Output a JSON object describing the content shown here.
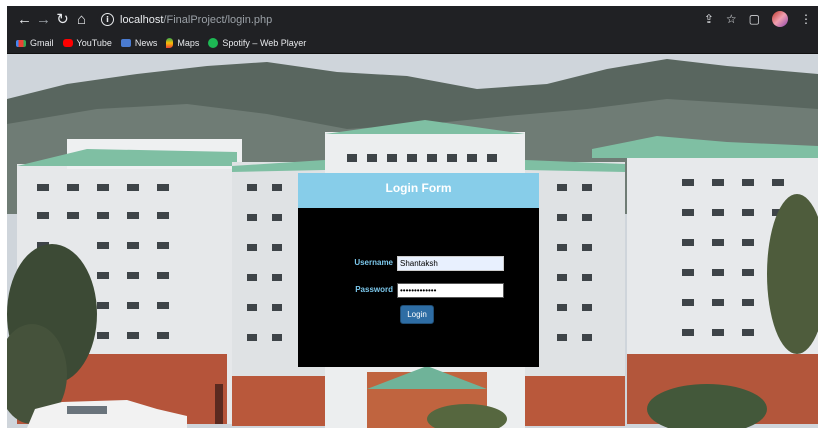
{
  "browser": {
    "url_host": "localhost",
    "url_path": "/FinalProject/login.php",
    "nav_icons": [
      "back-icon",
      "forward-icon",
      "reload-icon",
      "home-icon",
      "info-icon"
    ],
    "right_icons": [
      "share-icon",
      "star-icon",
      "sidepanel-icon",
      "profile-avatar",
      "menu-icon"
    ]
  },
  "bookmarks": [
    {
      "label": "Gmail",
      "icon": "gmail-icon"
    },
    {
      "label": "YouTube",
      "icon": "youtube-icon"
    },
    {
      "label": "News",
      "icon": "news-icon"
    },
    {
      "label": "Maps",
      "icon": "maps-icon"
    },
    {
      "label": "Spotify – Web Player",
      "icon": "spotify-icon"
    }
  ],
  "login": {
    "title": "Login Form",
    "username_label": "Username",
    "username_value": "Shantaksh",
    "password_label": "Password",
    "password_value": "•••••••••••••",
    "submit_label": "Login"
  },
  "colors": {
    "header_bg": "#87cde9",
    "form_bg": "#000000",
    "label_color": "#7cc8ec",
    "button_bg": "#2e6da4"
  }
}
